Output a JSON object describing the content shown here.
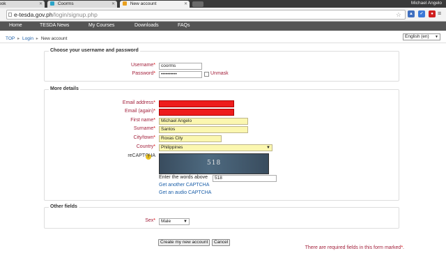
{
  "browser": {
    "tabs": [
      {
        "label": "ook"
      },
      {
        "label": "Coorms"
      },
      {
        "label": "New account"
      }
    ],
    "url_host": "e-tesda.gov.ph",
    "url_path": "/login/signup.php",
    "user_name": "Michael Angelo"
  },
  "nav": {
    "items": [
      "Home",
      "TESDA News",
      "My Courses",
      "Downloads",
      "FAQs"
    ]
  },
  "breadcrumb": {
    "top": "TOP",
    "login": "Login",
    "current": "New account",
    "sep": "▸"
  },
  "language": {
    "selected": "English (en)"
  },
  "section1": {
    "title": "Choose your username and password",
    "username_label": "Username",
    "username_value": "coorms",
    "password_label": "Password",
    "password_value": "••••••••••",
    "unmask_label": "Unmask"
  },
  "section2": {
    "title": "More details",
    "email_label": "Email address",
    "email_again_label": "Email (again)",
    "firstname_label": "First name",
    "firstname_value": "Michael Angelo",
    "surname_label": "Surname",
    "surname_value": "Santos",
    "city_label": "City/town",
    "city_value": "Roxas City",
    "country_label": "Country",
    "country_value": "Philippines",
    "recaptcha_label": "reCAPTCHA",
    "captcha_word": "518",
    "enter_words_label": "Enter the words above",
    "captcha_answer": "518",
    "another_captcha_link": "Get another CAPTCHA",
    "audio_captcha_link": "Get an audio CAPTCHA"
  },
  "section3": {
    "title": "Other fields",
    "sex_label": "Sex",
    "sex_value": "Male"
  },
  "actions": {
    "create_label": "Create my new account",
    "cancel_label": "Cancel"
  },
  "required_note": "There are required fields in this form marked",
  "colors": {
    "error_field": "#ee1c1c",
    "required_label": "#a3213c",
    "autofill_yellow": "#fbf7b0",
    "link": "#1a5ea8",
    "menubar": "#555555"
  }
}
